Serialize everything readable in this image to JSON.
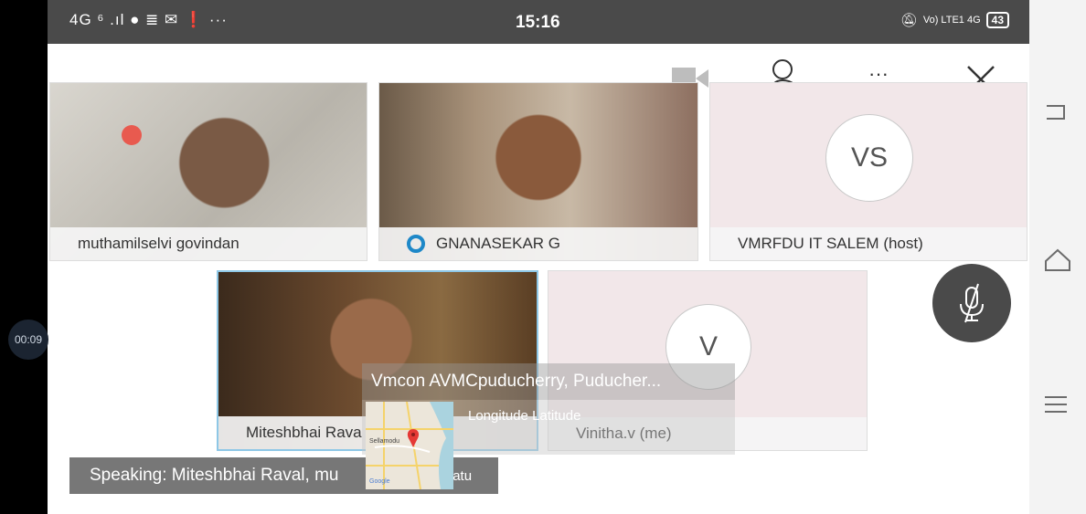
{
  "status_bar": {
    "left_icons": "4G ⁶ .ıl ● ≣ ✉ ❗ ···",
    "time": "15:16",
    "right_text": "Vo) LTE1 4G",
    "battery": "43"
  },
  "timer": "00:09",
  "toolbar": {
    "more": "···",
    "close": "✕"
  },
  "tiles": [
    {
      "name": "muthamilselvi govindan",
      "type": "video"
    },
    {
      "name": "GNANASEKAR G",
      "type": "video"
    },
    {
      "name": "VMRFDU IT SALEM (host)",
      "type": "avatar",
      "initials": "VS"
    },
    {
      "name": "Miteshbhai Rava",
      "type": "video"
    },
    {
      "name": "Vinitha.v (me)",
      "type": "avatar",
      "initials": "V"
    }
  ],
  "speaking": "Speaking: Miteshbhai Raval, mu",
  "speaking_tail": "v..Satu",
  "overlay": {
    "title": "Vmcon AVMCpuducherry, Puducher...",
    "coord_label": "Longitude Latitude"
  },
  "map": {
    "labels": [
      "Sellamodu",
      "Google"
    ]
  }
}
